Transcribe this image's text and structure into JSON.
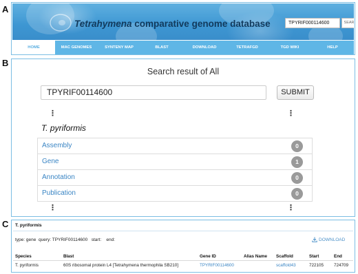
{
  "labels": {
    "a": "A",
    "b": "B",
    "c": "C"
  },
  "header": {
    "title_italic": "Tetrahymena",
    "title_rest": " comparative genome database",
    "search_value": "TPYRIF000114600",
    "search_button": "SEARCH"
  },
  "nav": {
    "items": [
      {
        "label": "HOME",
        "active": true
      },
      {
        "label": "MAC GENOMES",
        "active": false
      },
      {
        "label": "SYNTENY MAP",
        "active": false
      },
      {
        "label": "BLAST",
        "active": false
      },
      {
        "label": "DOWNLOAD",
        "active": false
      },
      {
        "label": "TETRAFGD",
        "active": false
      },
      {
        "label": "TGD WIKI",
        "active": false
      },
      {
        "label": "HELP",
        "active": false
      }
    ]
  },
  "search": {
    "heading": "Search result of All",
    "query": "TPYRIF00114600",
    "submit_label": "SUBMIT",
    "ellipsis": "⋮",
    "species": "T. pyriformis",
    "results": [
      {
        "label": "Assembly",
        "count": "0"
      },
      {
        "label": "Gene",
        "count": "1"
      },
      {
        "label": "Annotation",
        "count": "0"
      },
      {
        "label": "Publication",
        "count": "0"
      }
    ]
  },
  "detail": {
    "species": "T. pyriformis",
    "info_line": "type: gene  query: TPYRIF00114600   start:    end:",
    "download_label": "DOWNLOAD",
    "columns": {
      "species": "Species",
      "blast": "Blast",
      "gene_id": "Gene ID",
      "alias": "Alias Name",
      "scaffold": "Scaffold",
      "start": "Start",
      "end": "End"
    },
    "row": {
      "species": "T. pyriformis",
      "blast": "60S ribosomal protein L4 [Tetrahymena thermophila SB210]",
      "gene_id": "TPYRIF00114600",
      "alias": "",
      "scaffold": "scaffold43",
      "start": "722105",
      "end": "724709"
    }
  },
  "colors": {
    "banner": "#3d96d2",
    "nav": "#5fb6e6",
    "link": "#3a85c4",
    "badge": "#9a9a9a",
    "panel_border": "#7bbde3"
  }
}
